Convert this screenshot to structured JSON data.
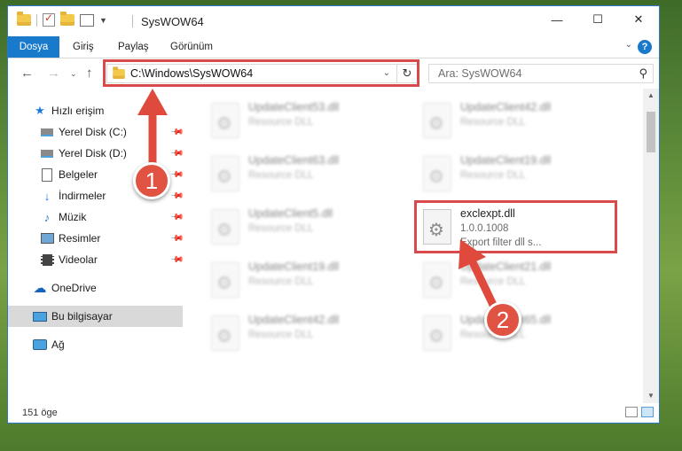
{
  "window": {
    "title": "SysWOW64"
  },
  "ribbon": {
    "tabs": [
      "Dosya",
      "Giriş",
      "Paylaş",
      "Görünüm"
    ]
  },
  "nav": {
    "address": "C:\\Windows\\SysWOW64",
    "search_placeholder": "Ara: SysWOW64"
  },
  "sidebar": {
    "items": [
      {
        "label": "Hızlı erişim",
        "icon": "star-icon"
      },
      {
        "label": "Yerel Disk (C:)",
        "icon": "drive-icon",
        "pinned": true
      },
      {
        "label": "Yerel Disk (D:)",
        "icon": "drive-icon",
        "pinned": true
      },
      {
        "label": "Belgeler",
        "icon": "document-icon",
        "pinned": true
      },
      {
        "label": "İndirmeler",
        "icon": "download-icon",
        "pinned": true
      },
      {
        "label": "Müzik",
        "icon": "music-icon",
        "pinned": true
      },
      {
        "label": "Resimler",
        "icon": "pictures-icon",
        "pinned": true
      },
      {
        "label": "Videolar",
        "icon": "video-icon",
        "pinned": true
      },
      {
        "label": "OneDrive",
        "icon": "cloud-icon"
      },
      {
        "label": "Bu bilgisayar",
        "icon": "computer-icon",
        "selected": true
      },
      {
        "label": "Ağ",
        "icon": "network-icon"
      }
    ]
  },
  "files": [
    {
      "name": "UpdateClient53.dll",
      "desc": "Resource DLL"
    },
    {
      "name": "UpdateClient42.dll",
      "desc": "Resource DLL"
    },
    {
      "name": "UpdateClient63.dll",
      "desc": "Resource DLL"
    },
    {
      "name": "UpdateClient19.dll",
      "desc": "Resource DLL"
    },
    {
      "name": "UpdateClient5.dll",
      "desc": "Resource DLL"
    },
    {
      "name": "exclexpt.dll",
      "version": "1.0.0.1008",
      "desc": "Export filter dll s...",
      "highlight": true
    },
    {
      "name": "UpdateClient19.dll",
      "desc": "Resource DLL"
    },
    {
      "name": "UpdateClient21.dll",
      "desc": "Resource DLL"
    },
    {
      "name": "UpdateClient42.dll",
      "desc": "Resource DLL"
    },
    {
      "name": "UpdateClient65.dll",
      "desc": "Resource DLL"
    }
  ],
  "status": {
    "count": "151 öge"
  },
  "annotations": {
    "step1": "1",
    "step2": "2",
    "color": "#d94b4b"
  }
}
